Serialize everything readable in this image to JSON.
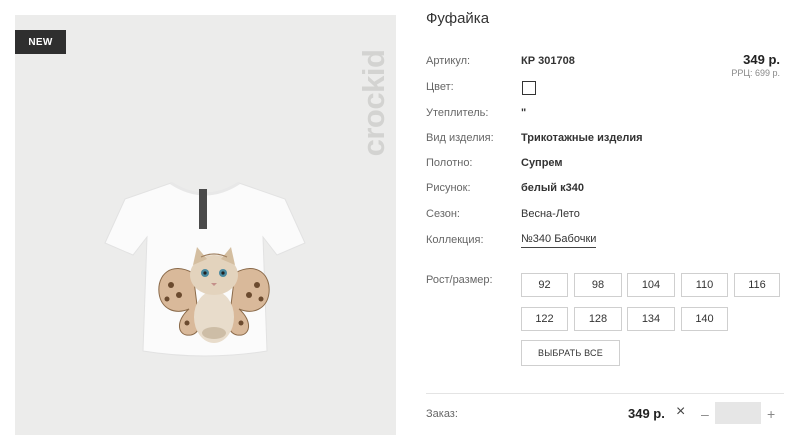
{
  "product": {
    "title": "Фуфайка",
    "new_badge": "NEW",
    "brand": "crockid",
    "price": "349 р.",
    "rrp": "РРЦ: 699 р."
  },
  "details": [
    {
      "label": "Артикул:",
      "value": "КР 301708"
    },
    {
      "label": "Цвет:",
      "value": ""
    },
    {
      "label": "Утеплитель:",
      "value": "\""
    },
    {
      "label": "Вид изделия:",
      "value": "Трикотажные изделия"
    },
    {
      "label": "Полотно:",
      "value": "Супрем"
    },
    {
      "label": "Рисунок:",
      "value": "белый к340"
    },
    {
      "label": "Сезон:",
      "value": "Весна-Лето"
    },
    {
      "label": "Коллекция:",
      "value": "№340 Бабочки"
    }
  ],
  "colors": {
    "swatch": "#ffffff"
  },
  "sizes": {
    "label": "Рост/размер:",
    "options": [
      "92",
      "98",
      "104",
      "110",
      "116",
      "122",
      "128",
      "134",
      "140"
    ],
    "select_all": "ВЫБРАТЬ ВСЕ"
  },
  "order": {
    "label": "Заказ:",
    "price": "349 р.",
    "clear_icon": "×",
    "minus_icon": "–",
    "plus_icon": "+",
    "quantity": ""
  }
}
